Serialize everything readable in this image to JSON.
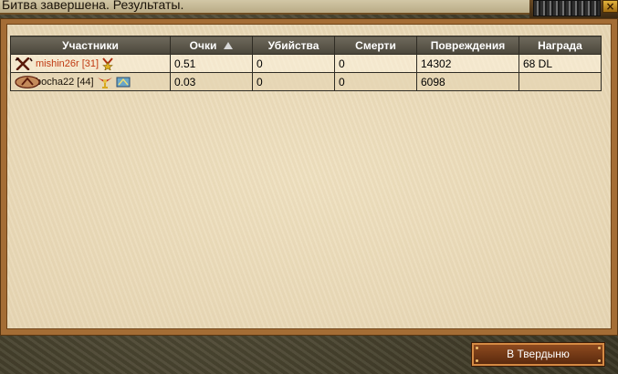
{
  "window": {
    "title": "Битва завершена. Результаты."
  },
  "table": {
    "headers": [
      "Участники",
      "Очки",
      "Убийства",
      "Смерти",
      "Повреждения",
      "Награда"
    ],
    "rows": [
      {
        "player": "mishin26r [31]",
        "faction_icon": "cross-swords-icon",
        "badges": [
          "medal-icon"
        ],
        "name_color": "#c03a12",
        "points": "0.51",
        "kills": "0",
        "deaths": "0",
        "damage": "14302",
        "reward": "68 DL"
      },
      {
        "player": "bocha22 [44]",
        "faction_icon": "triangle-emblem-icon",
        "badges": [
          "eagle-icon",
          "flag-icon"
        ],
        "name_color": "#1a1208",
        "points": "0.03",
        "kills": "0",
        "deaths": "0",
        "damage": "6098",
        "reward": ""
      }
    ],
    "sorted_column": "Очки",
    "sort_direction": "ascending"
  },
  "actions": {
    "return_label": "В Твердыню"
  },
  "colors": {
    "header_bg": "#5c5849",
    "frame_wood": "#a46d35",
    "parchment": "#efe1c1",
    "button_bg": "#7a3e18"
  }
}
